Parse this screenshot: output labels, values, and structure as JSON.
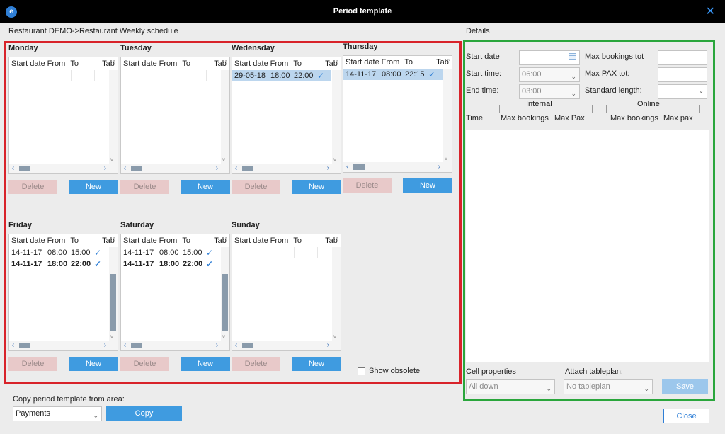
{
  "window": {
    "title": "Period template",
    "app_logo": "e",
    "close_icon": "✕"
  },
  "breadcrumb": "Restaurant DEMO->Restaurant Weekly schedule",
  "columns": {
    "start_date": "Start date",
    "from": "From",
    "to": "To",
    "tab": "Tab"
  },
  "days": [
    {
      "label": "Monday",
      "rows": []
    },
    {
      "label": "Tuesday",
      "rows": []
    },
    {
      "label": "Wedensday",
      "rows": [
        {
          "date": "29-05-18",
          "from": "18:00",
          "to": "22:00",
          "tab": "✓",
          "selected": true
        }
      ]
    },
    {
      "label": "Thursday",
      "rows": [
        {
          "date": "14-11-17",
          "from": "08:00",
          "to": "22:15",
          "tab": "✓",
          "selected": true
        }
      ]
    },
    {
      "label": "Friday",
      "rows": [
        {
          "date": "14-11-17",
          "from": "08:00",
          "to": "15:00",
          "tab": "✓",
          "selected": false
        },
        {
          "date": "14-11-17",
          "from": "18:00",
          "to": "22:00",
          "tab": "✓",
          "selected": false
        }
      ]
    },
    {
      "label": "Saturday",
      "rows": [
        {
          "date": "14-11-17",
          "from": "08:00",
          "to": "15:00",
          "tab": "✓",
          "selected": false
        },
        {
          "date": "14-11-17",
          "from": "18:00",
          "to": "22:00",
          "tab": "✓",
          "selected": false
        }
      ]
    },
    {
      "label": "Sunday",
      "rows": []
    }
  ],
  "buttons": {
    "delete": "Delete",
    "new": "New",
    "copy": "Copy",
    "save": "Save",
    "close": "Close"
  },
  "show_obsolete": "Show obsolete",
  "copy_from": {
    "label": "Copy period template from area:",
    "value": "Payments"
  },
  "details": {
    "heading": "Details",
    "start_date_label": "Start date",
    "start_time_label": "Start time:",
    "start_time_value": "06:00",
    "end_time_label": "End time:",
    "end_time_value": "03:00",
    "max_bookings_total_label": "Max bookings tot",
    "max_pax_total_label": "Max PAX tot:",
    "standard_length_label": "Standard length:",
    "internal_label": "Internal",
    "online_label": "Online",
    "col_time": "Time",
    "col_max_bookings_internal": "Max bookings",
    "col_max_pax_internal": "Max Pax",
    "col_max_bookings_online": "Max bookings",
    "col_max_pax_online": "Max pax",
    "cell_properties_label": "Cell properties",
    "cell_properties_value": "All down",
    "attach_tableplan_label": "Attach tableplan:",
    "attach_tableplan_value": "No tableplan"
  },
  "colors": {
    "red_frame": "#d8232a",
    "green_frame": "#2aa63c",
    "accent": "#3f9be0"
  }
}
